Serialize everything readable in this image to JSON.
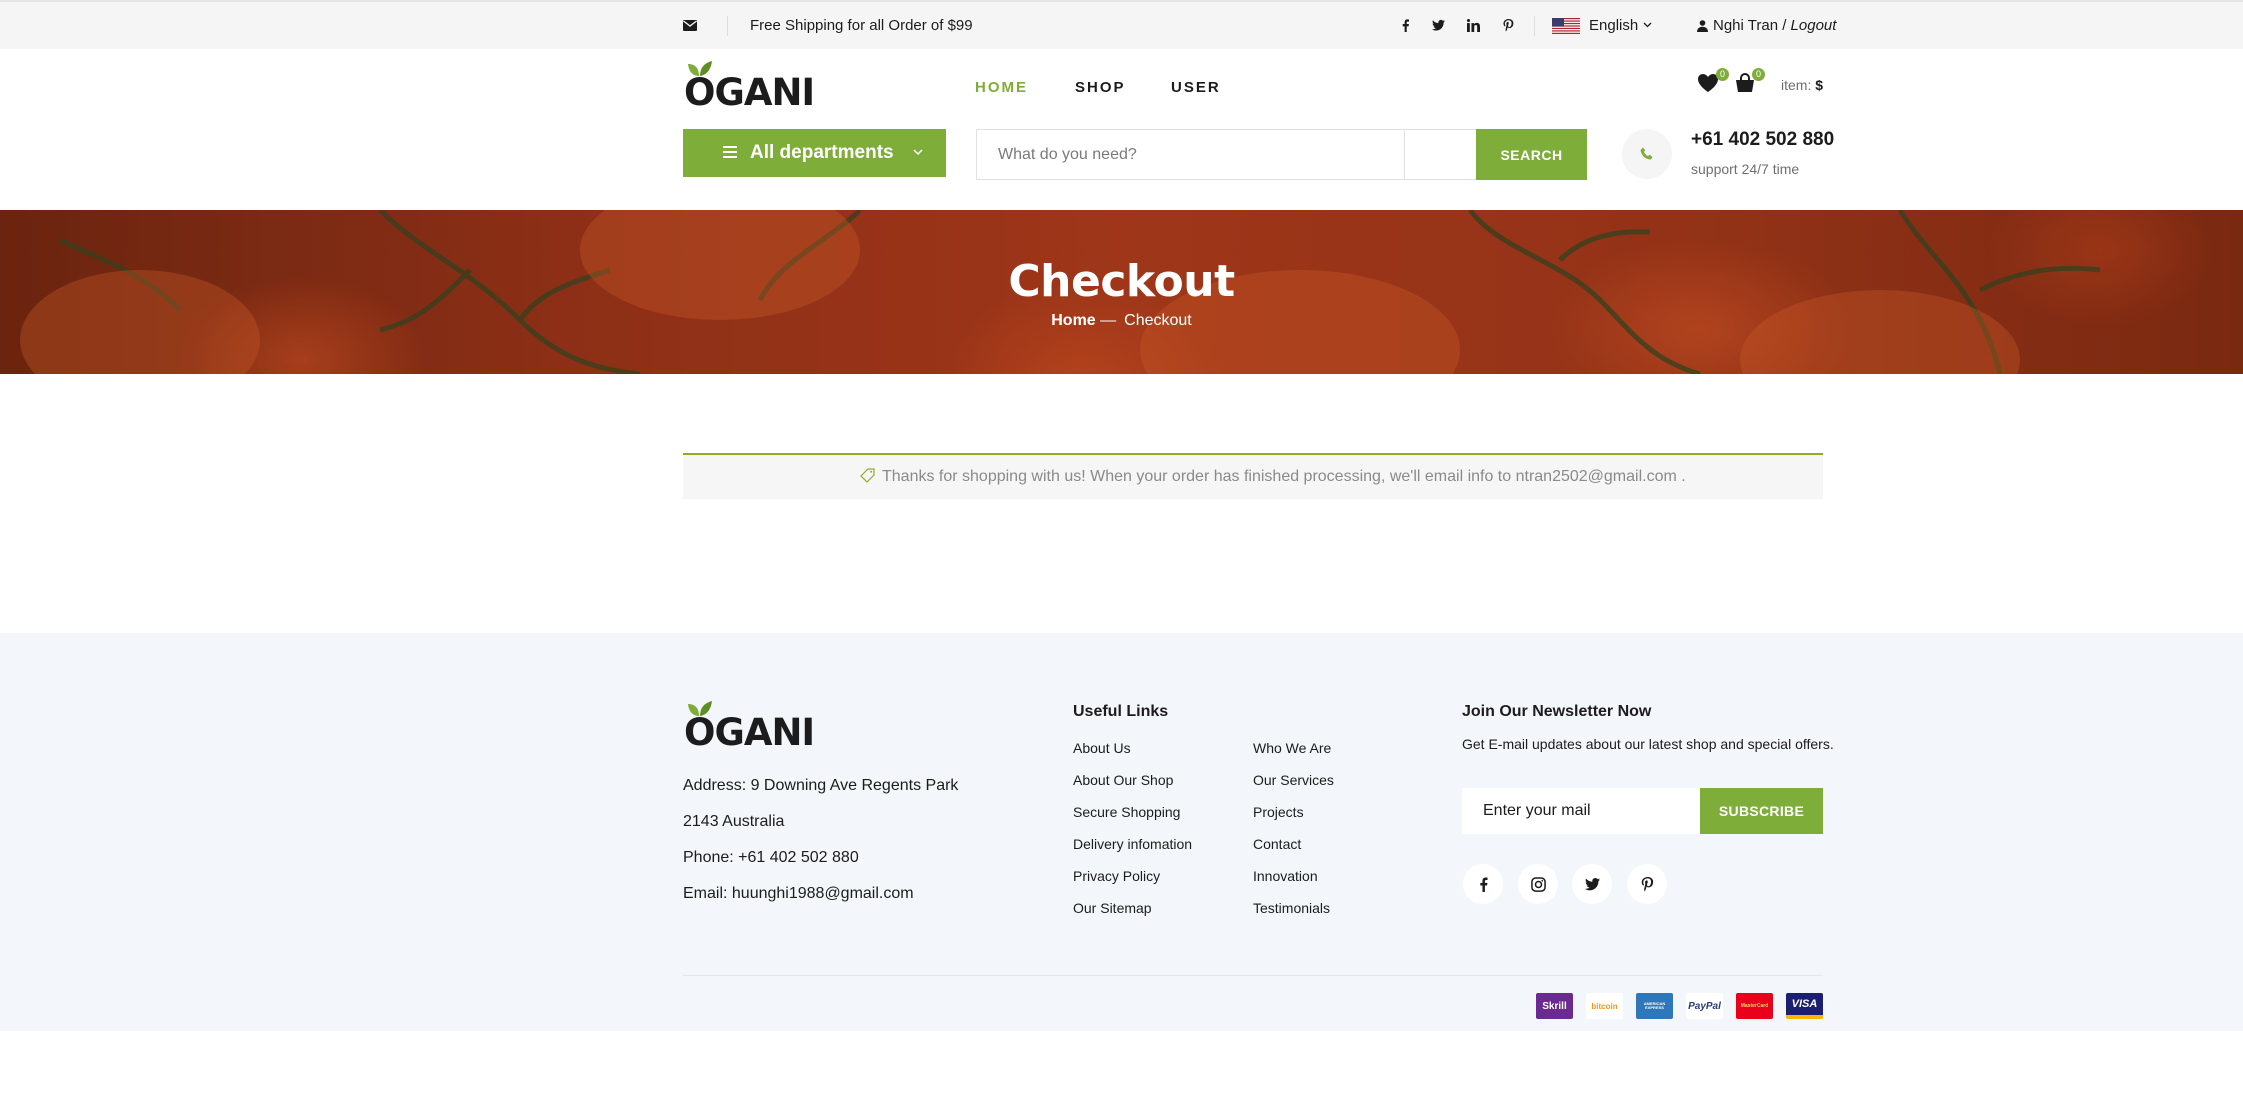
{
  "topbar": {
    "shipping_text": "Free Shipping for all Order of $99",
    "social_icons": [
      "facebook-icon",
      "twitter-icon",
      "linkedin-icon",
      "pinterest-icon"
    ],
    "language": "English",
    "user_name": "Nghi Tran /",
    "logout_label": "Logout"
  },
  "header": {
    "logo_text": "OGANI",
    "nav": [
      {
        "label": "HOME",
        "active": true
      },
      {
        "label": "SHOP",
        "active": false
      },
      {
        "label": "USER",
        "active": false
      }
    ],
    "wishlist_count": "0",
    "cart_count": "0",
    "item_label": "item:",
    "item_value": "$",
    "departments_label": "All departments",
    "search_placeholder": "What do you need?",
    "search_button": "SEARCH",
    "phone": "+61 402 502 880",
    "phone_sub": "support 24/7 time"
  },
  "banner": {
    "title": "Checkout",
    "breadcrumb_home": "Home",
    "breadcrumb_current": "Checkout"
  },
  "notice": {
    "message": "Thanks for shopping with us! When your order has finished processing, we'll email info to ntran2502@gmail.com ."
  },
  "footer": {
    "logo_text": "OGANI",
    "address_lines": [
      "Address: 9 Downing Ave Regents Park",
      "2143 Australia",
      "Phone: +61 402 502 880",
      "Email: huunghi1988@gmail.com"
    ],
    "useful_links_title": "Useful Links",
    "links_col1": [
      "About Us",
      "About Our Shop",
      "Secure Shopping",
      "Delivery infomation",
      "Privacy Policy",
      "Our Sitemap"
    ],
    "links_col2": [
      "Who We Are",
      "Our Services",
      "Projects",
      "Contact",
      "Innovation",
      "Testimonials"
    ],
    "newsletter_title": "Join Our Newsletter Now",
    "newsletter_sub": "Get E-mail updates about our latest shop and special offers.",
    "newsletter_placeholder": "Enter your mail",
    "subscribe_label": "SUBSCRIBE",
    "social_icons": [
      "facebook-icon",
      "instagram-icon",
      "twitter-icon",
      "pinterest-icon"
    ],
    "payments": [
      "Skrill",
      "bitcoin",
      "AMERICAN EXPRESS",
      "PayPal",
      "MasterCard",
      "VISA"
    ]
  },
  "colors": {
    "accent": "#7fad39",
    "notice_border": "#8fae1b",
    "topbar_bg": "#f5f5f5",
    "footer_bg": "#f3f6fa"
  }
}
